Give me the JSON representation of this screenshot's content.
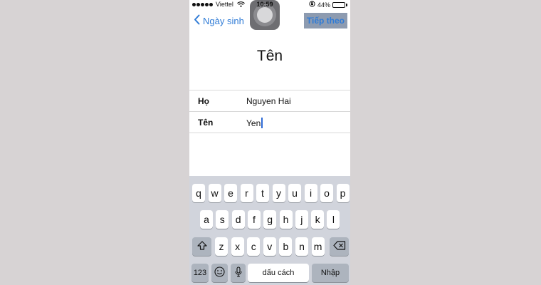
{
  "status_bar": {
    "carrier": "Viettel",
    "time": "10:59",
    "battery": "44%",
    "battery_level": 0.44
  },
  "nav": {
    "back_label": "Ngày sinh",
    "next_label": "Tiếp theo"
  },
  "page": {
    "title": "Tên"
  },
  "form": {
    "last_name_label": "Họ",
    "last_name_value": "Nguyen Hai",
    "first_name_label": "Tên",
    "first_name_value": "Yen"
  },
  "keyboard": {
    "row1": [
      "q",
      "w",
      "e",
      "r",
      "t",
      "y",
      "u",
      "i",
      "o",
      "p"
    ],
    "row2": [
      "a",
      "s",
      "d",
      "f",
      "g",
      "h",
      "j",
      "k",
      "l"
    ],
    "row3": [
      "z",
      "x",
      "c",
      "v",
      "b",
      "n",
      "m"
    ],
    "numbers_label": "123",
    "space_label": "dấu cách",
    "return_label": "Nhập"
  },
  "colors": {
    "accent": "#2f7bd6",
    "keyboard_bg": "#d1d4dc",
    "key_dark": "#adb4be"
  },
  "icons": {
    "back": "chevron-left-icon",
    "shift": "shift-icon",
    "delete": "backspace-icon",
    "emoji": "emoji-icon",
    "mic": "microphone-icon",
    "wifi": "wifi-icon",
    "lock": "rotation-lock-icon",
    "battery": "battery-icon",
    "assistive": "assistive-touch-icon"
  }
}
